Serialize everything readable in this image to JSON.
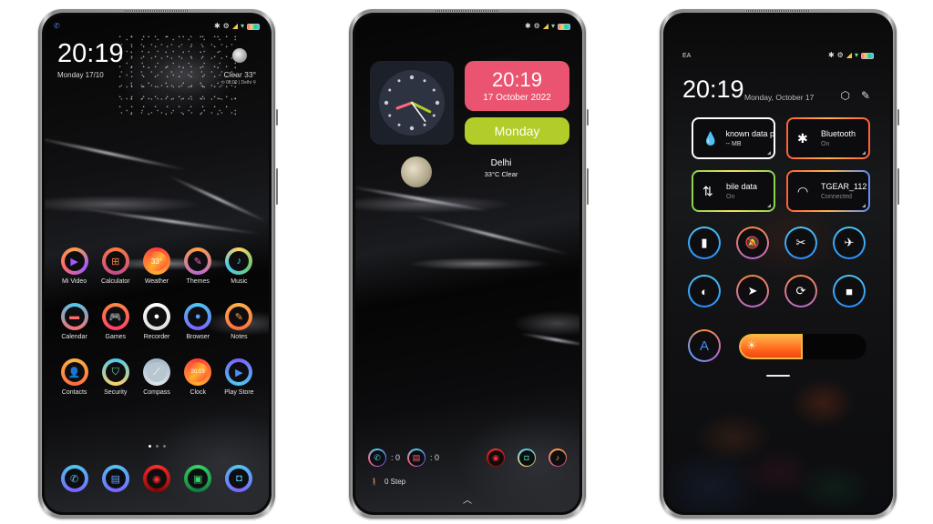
{
  "phones": {
    "home": {
      "status_bar": {
        "left_icon": "phone-icon",
        "icons": [
          "bluetooth-icon",
          "data-saver-icon",
          "signal-icon",
          "wifi-icon",
          "battery-icon"
        ]
      },
      "clock": {
        "time": "20:19",
        "date": "Monday  17/10"
      },
      "weather": {
        "condition_temp": "Clear  33°",
        "details": "⟲ 08:00 | Delhi ⚲",
        "icon": "moon-icon"
      },
      "apps": [
        {
          "label": "Mi Video",
          "icon": "play-icon",
          "glyph": "▶",
          "color": "#a259ff",
          "ring": "conic-gradient(#ff9f43,#a259ff,#ff6b6b,#ff9f43)"
        },
        {
          "label": "Calculator",
          "icon": "calculator-icon",
          "glyph": "⊞",
          "color": "#ff7a3d",
          "ring": "conic-gradient(#ff7a3d,#c04b8c,#ff7a3d)"
        },
        {
          "label": "Weather",
          "icon": "weather-icon",
          "glyph": "33°",
          "color": "#fff",
          "ring": "conic-gradient(#ff3b3b,#ffb02e,#ff3b3b)"
        },
        {
          "label": "Themes",
          "icon": "brush-icon",
          "glyph": "✎",
          "color": "#ff5fc8",
          "ring": "conic-gradient(#ff9f43,#b86ad1,#ff9f43)"
        },
        {
          "label": "Music",
          "icon": "music-note-icon",
          "glyph": "♪",
          "color": "#4cc9f0",
          "ring": "conic-gradient(#ffd166,#6bcb77,#4cc9f0,#ffd166)"
        },
        {
          "label": "Calendar",
          "icon": "calendar-icon",
          "glyph": "▬",
          "color": "#ff6b6b",
          "ring": "conic-gradient(#4cc9f0,#ff6b6b,#4cc9f0)"
        },
        {
          "label": "Games",
          "icon": "gamepad-icon",
          "glyph": "🎮",
          "color": "#ff8a3d",
          "ring": "conic-gradient(#ff8a3d,#ff3b6b,#ff8a3d)"
        },
        {
          "label": "Recorder",
          "icon": "record-icon",
          "glyph": "●",
          "color": "#ffffff",
          "ring": "conic-gradient(#ffffff,#dddddd,#ffffff)"
        },
        {
          "label": "Browser",
          "icon": "browser-icon",
          "glyph": "●",
          "color": "#5aa0ff",
          "ring": "conic-gradient(#4cc9f0,#7b61ff,#4cc9f0)"
        },
        {
          "label": "Notes",
          "icon": "notes-icon",
          "glyph": "✎",
          "color": "#ff9f43",
          "ring": "conic-gradient(#ffb347,#ff6b3d,#ffb347)"
        },
        {
          "label": "Contacts",
          "icon": "contact-icon",
          "glyph": "👤",
          "color": "#ff7a3d",
          "ring": "conic-gradient(#ffb347,#ff6b3d,#ffb347)"
        },
        {
          "label": "Security",
          "icon": "shield-icon",
          "glyph": "⛉",
          "color": "#7ee0a0",
          "ring": "conic-gradient(#4cc9f0,#ffd166,#4cc9f0)"
        },
        {
          "label": "Compass",
          "icon": "compass-icon",
          "glyph": "⟋",
          "color": "#cfd8e0",
          "ring": "conic-gradient(#9fb3c8,#e0e6ec,#9fb3c8)"
        },
        {
          "label": "Clock",
          "icon": "clock-icon",
          "glyph": "20:19",
          "color": "#fff",
          "ring": "conic-gradient(#ff3b3b,#ffb02e,#ff3b3b)"
        },
        {
          "label": "Play Store",
          "icon": "play-store-icon",
          "glyph": "▶",
          "color": "#4c8dff",
          "ring": "conic-gradient(#7b61ff,#4cc9f0,#7b61ff)"
        }
      ],
      "page_dots": {
        "count": 3,
        "active": 0
      },
      "dock": [
        {
          "icon": "phone-icon",
          "glyph": "✆",
          "color": "#4cc9f0",
          "ring": "conic-gradient(#4cc9f0,#7b61ff,#4cc9f0)"
        },
        {
          "icon": "messages-icon",
          "glyph": "▤",
          "color": "#5aa0ff",
          "ring": "conic-gradient(#4cc9f0,#7b61ff,#4cc9f0)"
        },
        {
          "icon": "browser-icon",
          "glyph": "◉",
          "color": "#ff2d2d",
          "ring": "conic-gradient(#ff2d2d,#8b0000,#ff2d2d)"
        },
        {
          "icon": "gallery-icon",
          "glyph": "▣",
          "color": "#36d36b",
          "ring": "conic-gradient(#36d36b,#0f7a3a,#36d36b)"
        },
        {
          "icon": "camera-icon",
          "glyph": "◘",
          "color": "#4cc9f0",
          "ring": "conic-gradient(#4cc9f0,#7b61ff,#4cc9f0)"
        }
      ]
    },
    "widgets": {
      "status_bar": {
        "icons": [
          "bluetooth-icon",
          "data-saver-icon",
          "signal-icon",
          "wifi-icon",
          "battery-icon"
        ]
      },
      "analog_clock": {
        "hours": 20,
        "minutes": 19,
        "seconds": 24
      },
      "date_widget": {
        "time": "20:19",
        "date": "17 October 2022",
        "color": "#ea5470"
      },
      "day_widget": {
        "day": "Monday",
        "color": "#b2cc2a"
      },
      "weather": {
        "city": "Delhi",
        "condition": "33°C Clear"
      },
      "notifications": [
        {
          "icon": "phone-icon",
          "glyph": "✆",
          "color": "#4cc9f0",
          "count": ": 0"
        },
        {
          "icon": "messages-icon",
          "glyph": "▤",
          "color": "#ff5f7e",
          "count": ": 0"
        }
      ],
      "shortcuts": [
        {
          "icon": "browser-icon",
          "glyph": "◉",
          "color": "#ff2d2d",
          "ring": "conic-gradient(#ff2d2d,#8b0000,#ff2d2d)"
        },
        {
          "icon": "camera-icon",
          "glyph": "◘",
          "color": "#36d3a0",
          "ring": "conic-gradient(#4cc9f0,#ffd166,#4cc9f0)"
        },
        {
          "icon": "music-note-icon",
          "glyph": "♪",
          "color": "#ff9f43",
          "ring": "conic-gradient(#ff9f43,#c04b8c,#ff9f43)"
        }
      ],
      "steps": "0 Step",
      "swipe_up_icon": "chevron-up-icon"
    },
    "control_center": {
      "carrier": "EA",
      "status_bar": {
        "icons": [
          "bluetooth-icon",
          "data-saver-icon",
          "signal-icon",
          "wifi-icon",
          "battery-icon"
        ]
      },
      "time": "20:19",
      "date": "Monday, October 17",
      "tools": [
        {
          "icon": "settings-icon",
          "glyph": "⬡"
        },
        {
          "icon": "edit-icon",
          "glyph": "✎"
        }
      ],
      "tiles": [
        {
          "name": "data-usage",
          "icon": "water-drop-icon",
          "glyph": "💧",
          "title": "known data pla",
          "subtitle": "-- MB",
          "border": "#ffffff"
        },
        {
          "name": "bluetooth",
          "icon": "bluetooth-icon",
          "glyph": "✱",
          "title": "Bluetooth",
          "subtitle": "On",
          "border": "linear-gradient(90deg,#ff5e3a,#ffb347,#ff5e3a)"
        },
        {
          "name": "mobile-data",
          "icon": "data-arrows-icon",
          "glyph": "⇅",
          "title": "bile data",
          "subtitle": "On",
          "border": "linear-gradient(90deg,#8bd34c,#f6e05e,#8bd34c)"
        },
        {
          "name": "wifi",
          "icon": "wifi-icon",
          "glyph": "◠",
          "title": "TGEAR_112",
          "subtitle": "Connected",
          "border": "linear-gradient(90deg,#ff5e3a,#ffb347,#5a8dff)"
        }
      ],
      "toggles": [
        {
          "name": "flashlight",
          "icon": "flashlight-icon",
          "glyph": "▮",
          "ring": "conic-gradient(#4cc9f0,#2b8cff,#4cc9f0)"
        },
        {
          "name": "mute",
          "icon": "bell-off-icon",
          "glyph": "🔕",
          "ring": "conic-gradient(#ff8a3d,#b86ad1,#ff8a3d)"
        },
        {
          "name": "screenshot",
          "icon": "scissors-icon",
          "glyph": "✂",
          "ring": "conic-gradient(#4cc9f0,#2b8cff,#4cc9f0)"
        },
        {
          "name": "airplane",
          "icon": "airplane-icon",
          "glyph": "✈",
          "ring": "conic-gradient(#4cc9f0,#2b8cff,#4cc9f0)"
        },
        {
          "name": "dark-mode",
          "icon": "contrast-icon",
          "glyph": "◐",
          "ring": "conic-gradient(#4cc9f0,#2b8cff,#4cc9f0)"
        },
        {
          "name": "location",
          "icon": "location-arrow-icon",
          "glyph": "➤",
          "ring": "conic-gradient(#ff8a3d,#b86ad1,#ff8a3d)"
        },
        {
          "name": "rotation-lock",
          "icon": "rotation-lock-icon",
          "glyph": "⟳",
          "ring": "conic-gradient(#ff8a3d,#b86ad1,#ff8a3d)"
        },
        {
          "name": "screen-record",
          "icon": "video-camera-icon",
          "glyph": "■",
          "ring": "conic-gradient(#4cc9f0,#2b8cff,#4cc9f0)"
        }
      ],
      "auto_brightness": {
        "label": "A",
        "icon": "auto-brightness-icon"
      },
      "brightness": {
        "value": 0.5,
        "icon": "sun-icon",
        "glyph": "☀"
      }
    }
  }
}
